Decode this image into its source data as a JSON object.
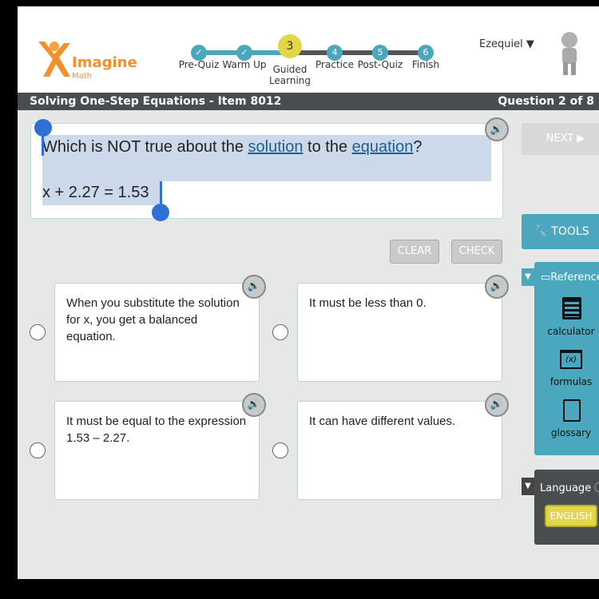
{
  "logo": {
    "name": "Imagine",
    "sub": "Math"
  },
  "steps": [
    {
      "label": "Pre-Quiz",
      "marker": "check"
    },
    {
      "label": "Warm Up",
      "marker": "check"
    },
    {
      "label": "Guided Learning",
      "marker": "3"
    },
    {
      "label": "Practice",
      "marker": "4"
    },
    {
      "label": "Post-Quiz",
      "marker": "5"
    },
    {
      "label": "Finish",
      "marker": "6"
    }
  ],
  "user": {
    "name": "Ezequiel"
  },
  "titlebar": {
    "title": "Solving One-Step Equations - Item 8012",
    "progress": "Question 2 of 8"
  },
  "question": {
    "pre": "Which is NOT true about the ",
    "link1": "solution",
    "mid": " to the ",
    "link2": "equation",
    "post": "?",
    "equation": "x + 2.27 = 1.53"
  },
  "buttons": {
    "clear": "CLEAR",
    "check": "CHECK",
    "next": "NEXT ▶",
    "tools": "TOOLS"
  },
  "answers": [
    "When you substitute the solution for x, you get a balanced equation.",
    "It must be less than 0.",
    "It must be equal to the expression 1.53 – 2.27.",
    "It can have different values."
  ],
  "reference": {
    "title": "Reference",
    "items": [
      "calculator",
      "formulas",
      "glossary"
    ]
  },
  "language": {
    "title": "Language",
    "value": "ENGLISH"
  },
  "colors": {
    "teal": "#4aa7bd",
    "yellow": "#e2d64a",
    "selection": "#ccd9ea",
    "handle": "#2f6fd6"
  }
}
